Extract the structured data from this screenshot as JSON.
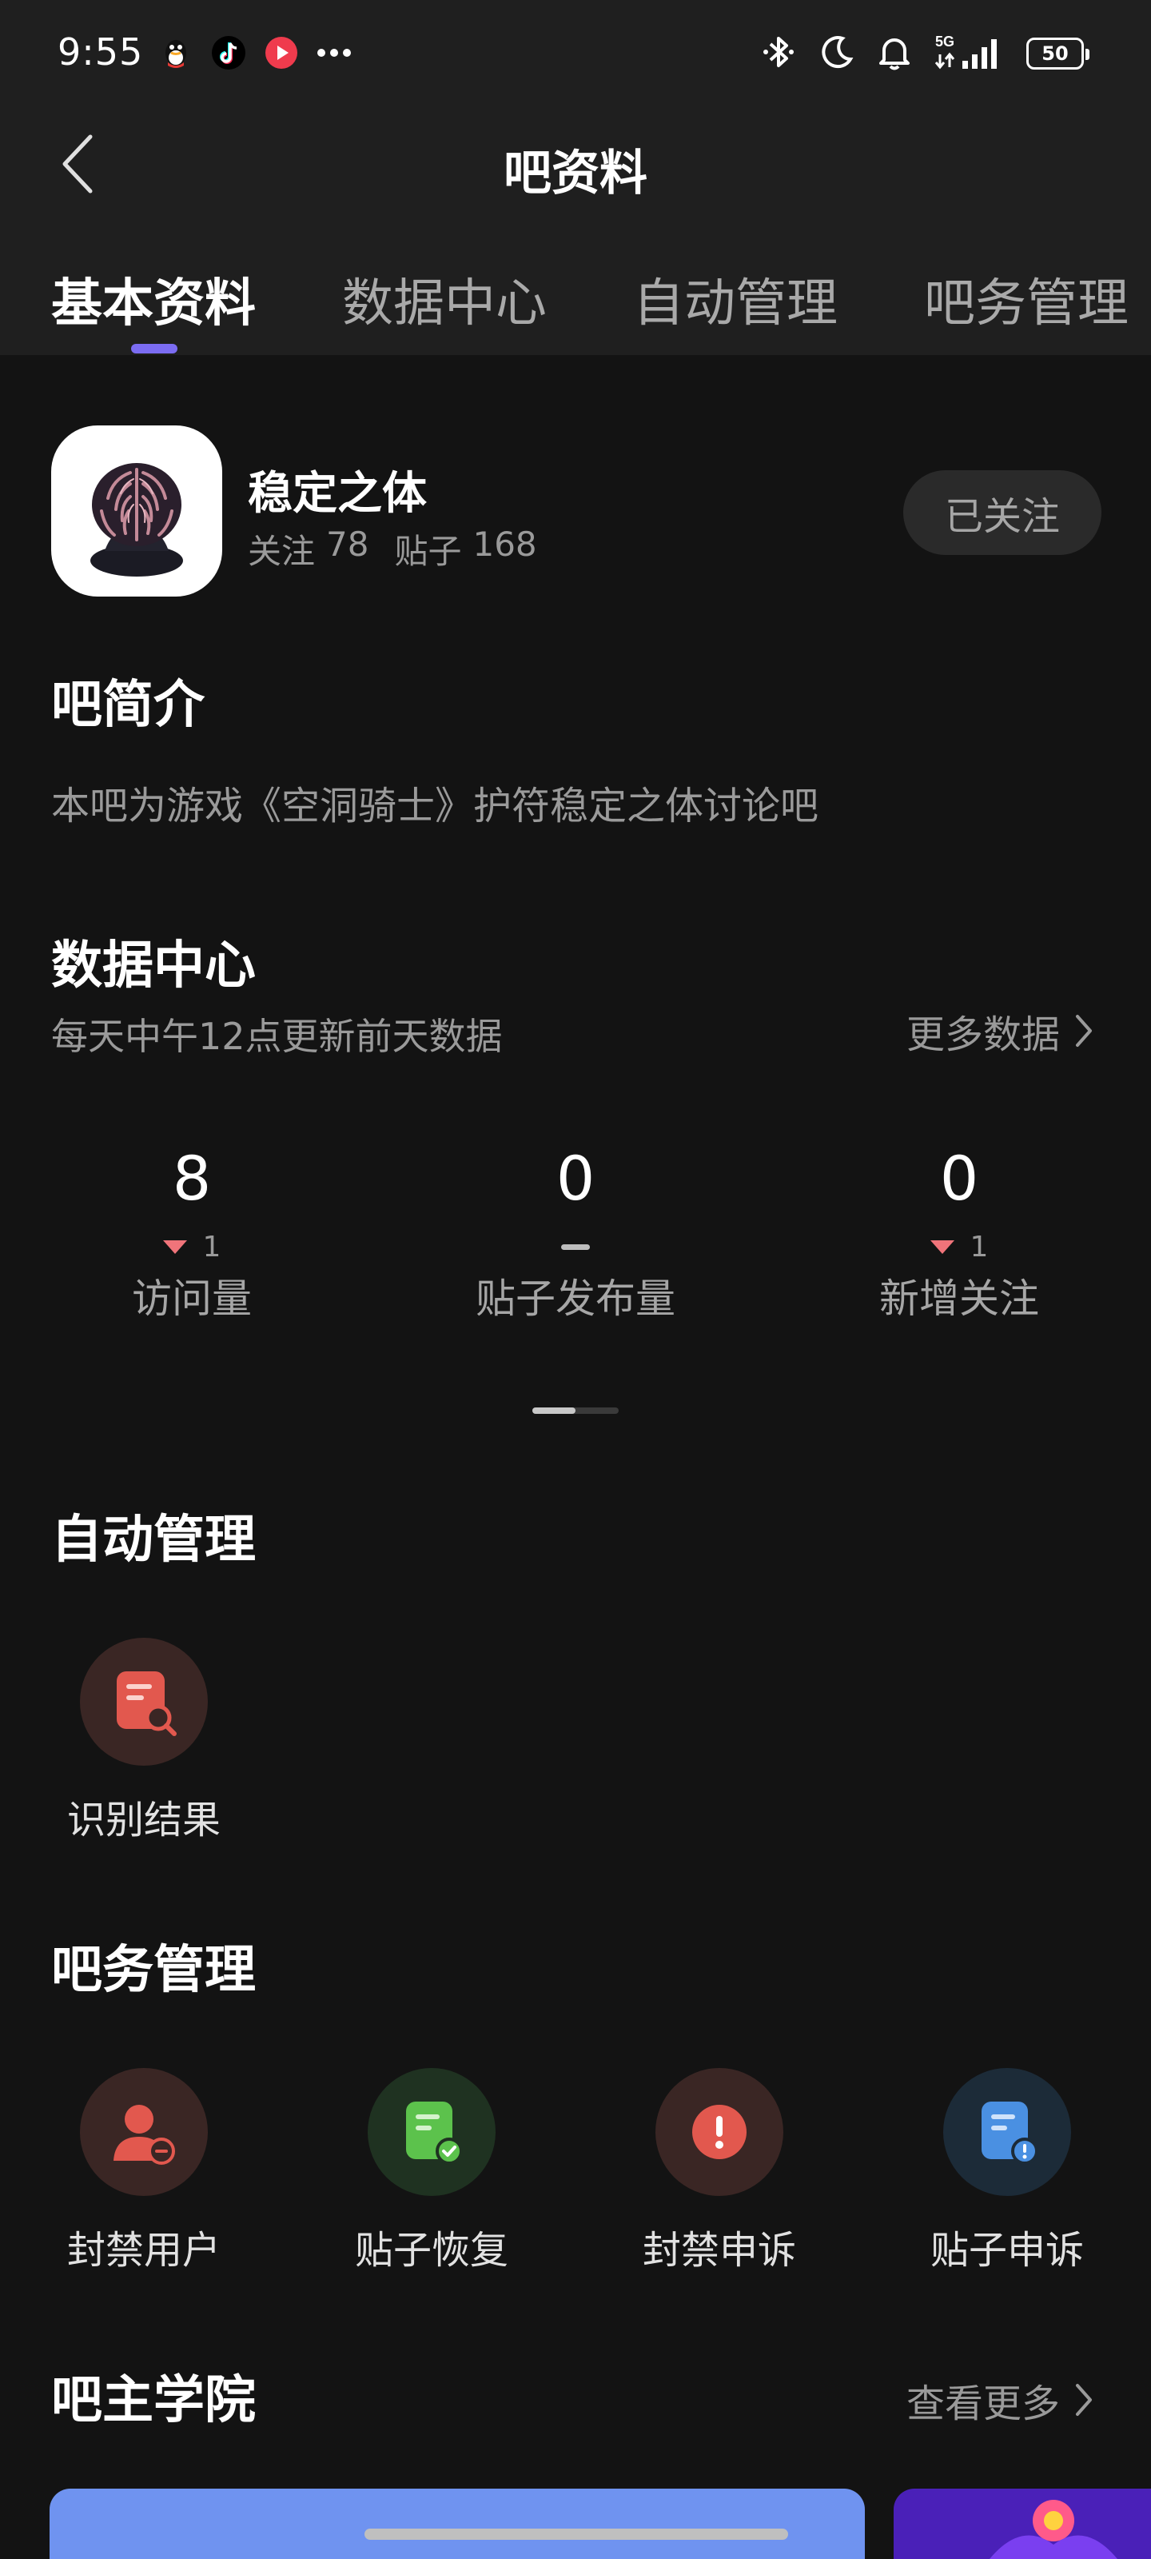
{
  "status_bar": {
    "time": "9:55",
    "left_icons": [
      "qq-icon",
      "tiktok-icon",
      "video-app-icon",
      "more-dots-icon"
    ],
    "right_icons": [
      "bluetooth-icon",
      "moon-icon",
      "bell-icon",
      "signal-5g-icon"
    ],
    "network": "5G",
    "battery": "50"
  },
  "nav": {
    "title": "吧资料"
  },
  "tabs": [
    {
      "label": "基本资料",
      "active": true
    },
    {
      "label": "数据中心",
      "active": false
    },
    {
      "label": "自动管理",
      "active": false
    },
    {
      "label": "吧务管理",
      "active": false
    }
  ],
  "forum": {
    "name": "稳定之体",
    "follow_label": "关注",
    "follow_count": "78",
    "post_label": "贴子",
    "post_count": "168",
    "follow_button": "已关注"
  },
  "intro": {
    "title": "吧简介",
    "text": "本吧为游戏《空洞骑士》护符稳定之体讨论吧"
  },
  "data_center": {
    "title": "数据中心",
    "subtitle": "每天中午12点更新前天数据",
    "more": "更多数据",
    "stats": [
      {
        "value": "8",
        "delta": "1",
        "trend": "down",
        "label": "访问量"
      },
      {
        "value": "0",
        "delta": "",
        "trend": "flat",
        "label": "贴子发布量"
      },
      {
        "value": "0",
        "delta": "1",
        "trend": "down",
        "label": "新增关注"
      }
    ]
  },
  "auto_manage": {
    "title": "自动管理",
    "tools": [
      {
        "label": "识别结果",
        "icon": "doc-search-icon",
        "color": "#e2584e"
      }
    ]
  },
  "forum_manage": {
    "title": "吧务管理",
    "tools": [
      {
        "label": "封禁用户",
        "icon": "ban-user-icon",
        "color": "#e2584e"
      },
      {
        "label": "贴子恢复",
        "icon": "post-restore-icon",
        "color": "#5cc24c"
      },
      {
        "label": "封禁申诉",
        "icon": "ban-appeal-icon",
        "color": "#e2584e"
      },
      {
        "label": "贴子申诉",
        "icon": "post-appeal-icon",
        "color": "#4a90e2"
      }
    ]
  },
  "academy": {
    "title": "吧主学院",
    "more": "查看更多"
  },
  "colors": {
    "background": "#131313",
    "header": "#1f1f1f",
    "accent": "#7b6cf2",
    "down_trend": "#f0747a"
  }
}
